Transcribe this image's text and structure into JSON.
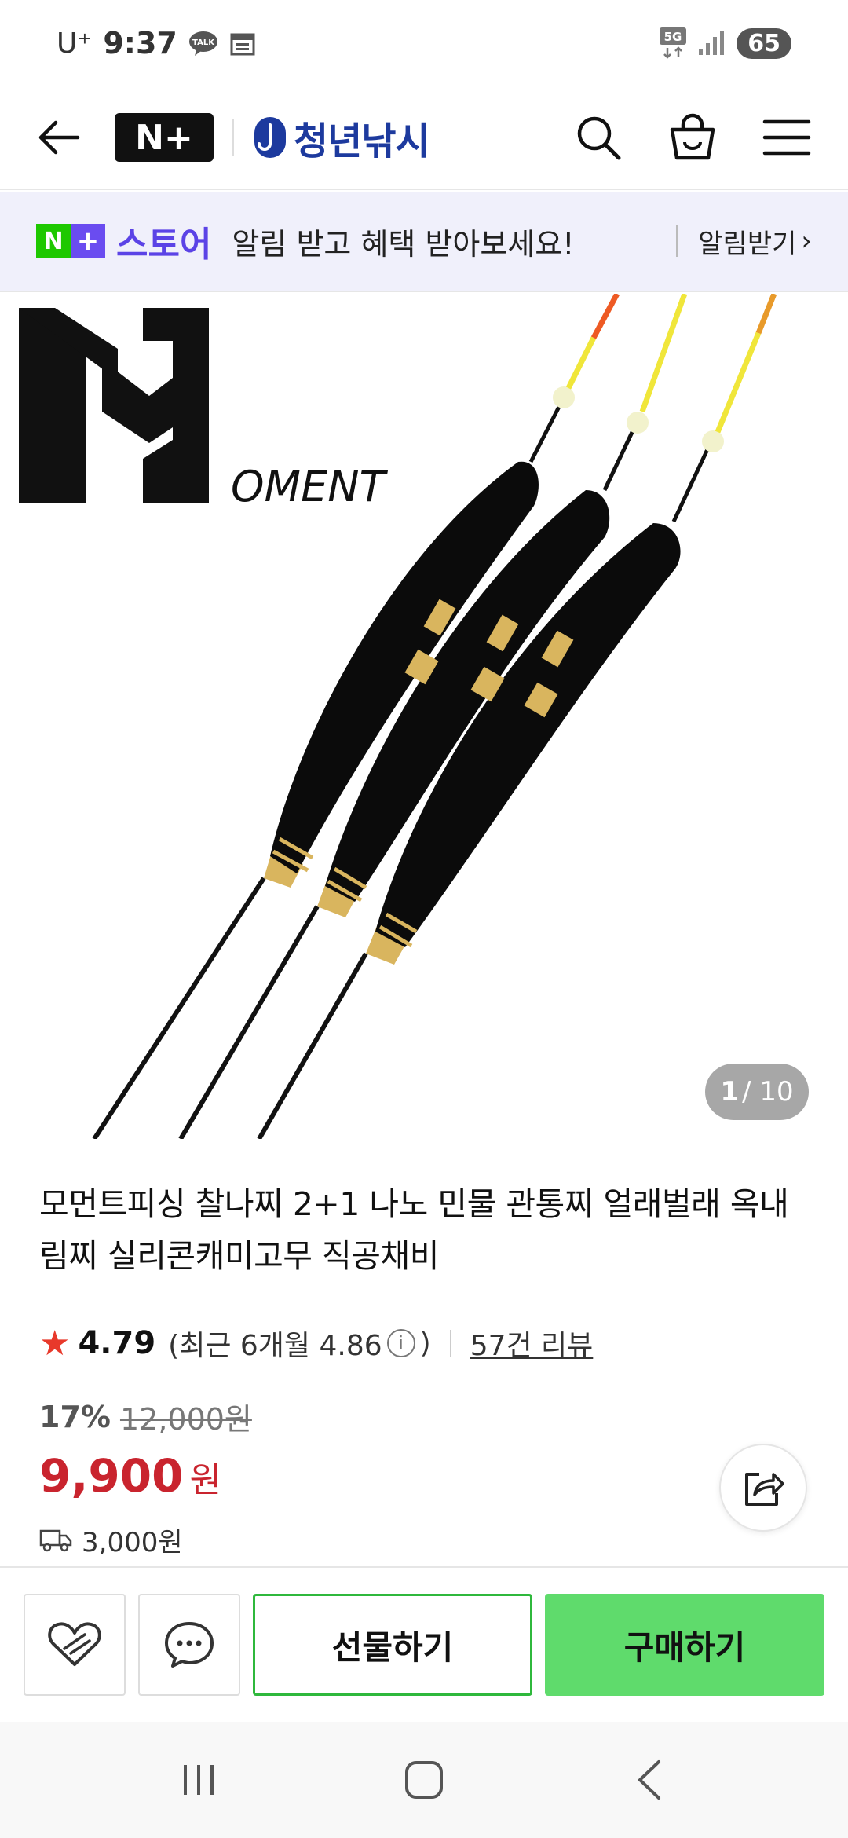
{
  "status_bar": {
    "carrier": "U⁺",
    "time": "9:37",
    "network": "5G",
    "battery": "65"
  },
  "nav": {
    "brand_badge": "N+",
    "store_name": "청년낚시"
  },
  "banner": {
    "badge_n": "N",
    "badge_plus": "+",
    "badge_text": "스토어",
    "message": "알림 받고 혜택 받아보세요!",
    "notify_label": "알림받기",
    "notify_chevron": "›"
  },
  "product_image": {
    "logo_text": "OMENT",
    "counter_current": "1",
    "counter_total": "/ 10"
  },
  "product": {
    "title": "모먼트피싱 찰나찌 2+1 나노 민물 관통찌 얼래벌래 옥내림찌 실리콘캐미고무 직공채비",
    "rating": "4.79",
    "recent_rating": "(최근 6개월 4.86",
    "recent_close": ")",
    "review_count": "57건 리뷰",
    "discount": "17%",
    "original_price": "12,000원",
    "price": "9,900",
    "price_unit": "원",
    "shipping": "3,000원"
  },
  "actions": {
    "gift_label": "선물하기",
    "buy_label": "구매하기"
  },
  "colors": {
    "accent_green": "#5fdb6c",
    "price_red": "#c9242e",
    "store_purple": "#5b43e6",
    "store_blue": "#1d3a9e"
  }
}
